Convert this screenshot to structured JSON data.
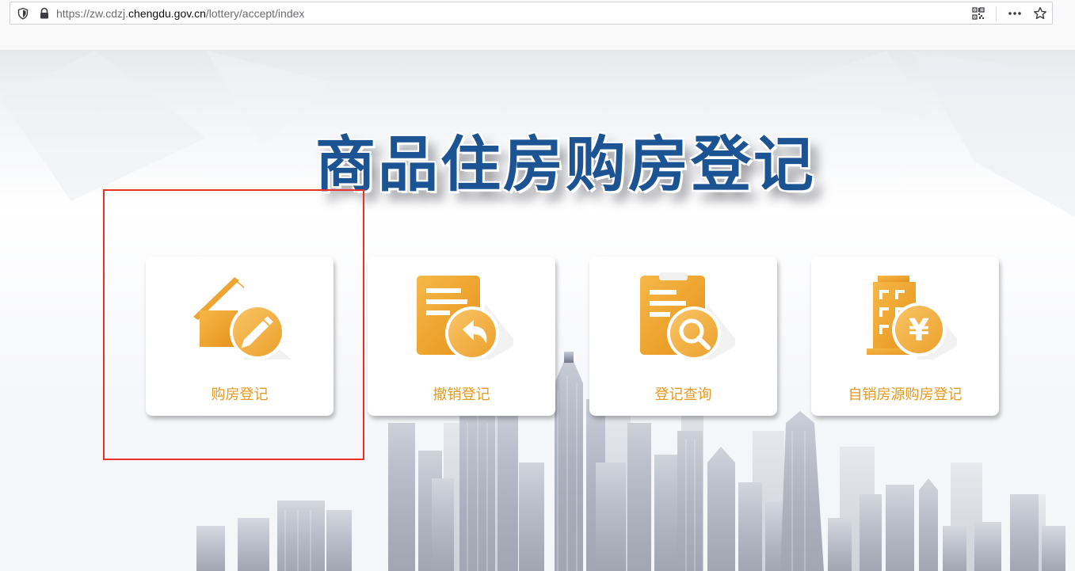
{
  "browser": {
    "url_prefix": "https://zw.cdzj.",
    "url_host": "chengdu.gov.cn",
    "url_path": "/lottery/accept/index",
    "icons": [
      "shield-icon",
      "lock-icon",
      "qr-code-icon",
      "more-actions-icon",
      "bookmark-star-icon"
    ]
  },
  "page": {
    "title": "商品住房购房登记",
    "cards": [
      {
        "label": "购房登记",
        "icon": "house-edit-icon"
      },
      {
        "label": "撤销登记",
        "icon": "document-undo-icon"
      },
      {
        "label": "登记查询",
        "icon": "document-search-icon"
      },
      {
        "label": "自销房源购房登记",
        "icon": "building-yuan-icon"
      }
    ]
  },
  "colors": {
    "title": "#1c5493",
    "accent": "#f0a21e",
    "label": "#e39a20",
    "highlight": "#e8312a"
  }
}
